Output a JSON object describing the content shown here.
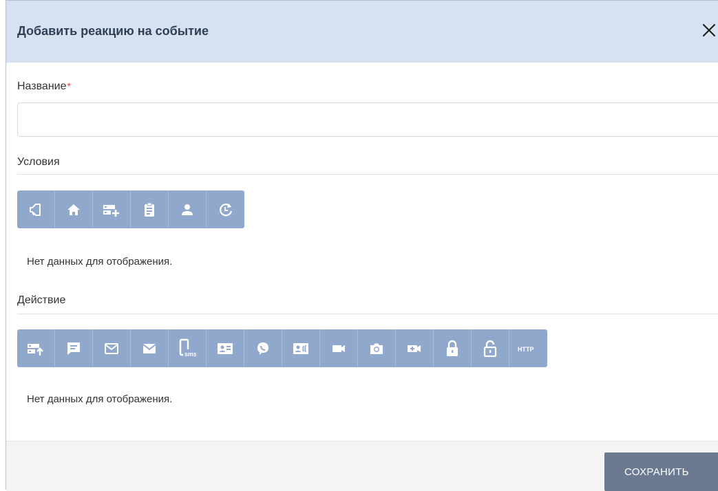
{
  "dialog": {
    "title": "Добавить реакцию на событие",
    "close_icon": "close-icon"
  },
  "name_field": {
    "label": "Название",
    "required_mark": "*",
    "value": "",
    "placeholder": ""
  },
  "conditions": {
    "label": "Условия",
    "empty_text": "Нет данных для отображения.",
    "tools": [
      "megaphone-icon",
      "home-icon",
      "device-add-icon",
      "clipboard-icon",
      "user-icon",
      "schedule-icon"
    ]
  },
  "actions": {
    "label": "Действие",
    "empty_text": "Нет данных для отображения.",
    "http_text": "HTTP",
    "sms_text": "sms",
    "tools": [
      "device-upload-icon",
      "chat-icon",
      "mail-outline-icon",
      "mail-filled-icon",
      "phone-sms-icon",
      "contact-card-icon",
      "viber-icon",
      "contact-call-icon",
      "video-camera-icon",
      "photo-camera-icon",
      "video-add-icon",
      "lock-icon",
      "unlock-icon",
      "http-icon"
    ]
  },
  "footer": {
    "save_label": "СОХРАНИТЬ"
  },
  "colors": {
    "header_bg": "#d6e2ef",
    "toolbar_bg": "#90a8cc",
    "save_bg": "#6b7a90",
    "required": "#e23b3b"
  }
}
